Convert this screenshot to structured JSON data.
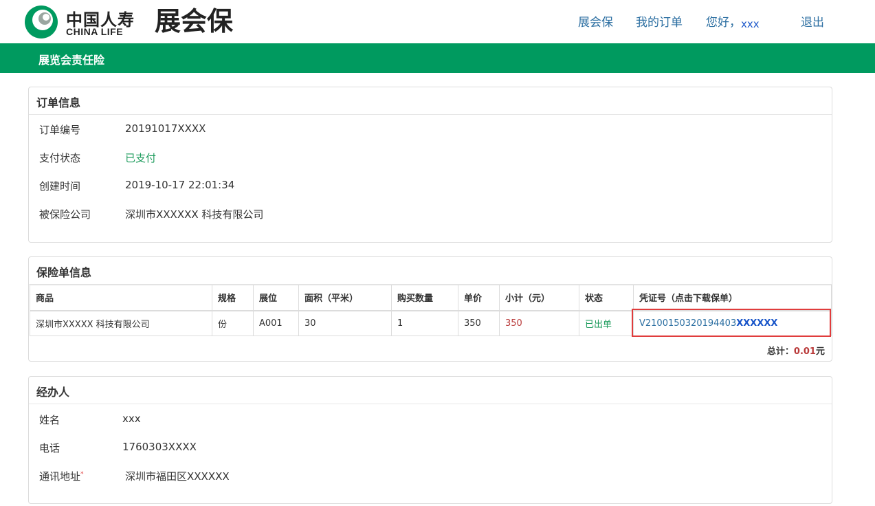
{
  "brand": {
    "cn": "中国人寿",
    "en": "CHINA LIFE",
    "product": "展会保"
  },
  "nav": {
    "home": "展会保",
    "orders": "我的订单",
    "greeting": "您好，",
    "user": "xxx",
    "logout": "退出"
  },
  "page_title": "展览会责任险",
  "order_info": {
    "title": "订单信息",
    "fields": [
      {
        "label": "订单编号",
        "value": "20191017XXXX"
      },
      {
        "label": "支付状态",
        "value": "已支付"
      },
      {
        "label": "创建时间",
        "value": "2019-10-17 22:01:34"
      },
      {
        "label": "被保险公司",
        "value": "深圳市XXXXXX 科技有限公司"
      }
    ]
  },
  "policy_info": {
    "title": "保险单信息",
    "headers": [
      "商品",
      "规格",
      "展位",
      "面积（平米）",
      "购买数量",
      "单价",
      "小计（元）",
      "状态",
      "凭证号（点击下载保单）"
    ],
    "row": {
      "product": "深圳市XXXXX 科技有限公司",
      "spec": "份",
      "booth": "A001",
      "area": "30",
      "qty": "1",
      "unit_price": "350",
      "subtotal": "350",
      "status": "已出单",
      "cert_prefix": "V2100150320194403",
      "cert_suffix": "XXXXXX"
    },
    "total_label": "总计：",
    "total_amount": "0.01",
    "total_unit": "元"
  },
  "agent": {
    "title": "经办人",
    "fields": [
      {
        "label": "姓名",
        "value": "xxx"
      },
      {
        "label": "电话",
        "value": "1760303XXXX"
      },
      {
        "label": "通讯地址",
        "value": "深圳市福田区XXXXXX"
      }
    ],
    "required_mark": "*"
  },
  "colors": {
    "brand_green": "#009a5f",
    "link_blue": "#2b6ea1",
    "paid_green": "#1a9a5a",
    "price_red": "#b93a3a",
    "highlight_red": "#e03c3c"
  }
}
